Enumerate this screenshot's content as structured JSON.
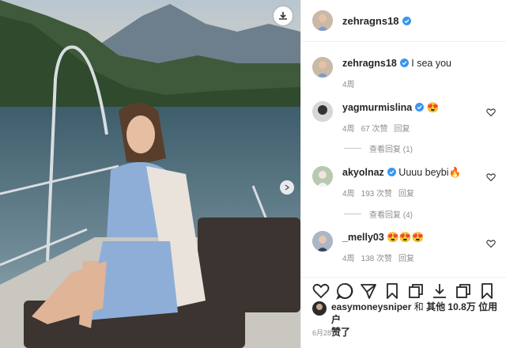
{
  "post": {
    "author": "zehragns18",
    "caption": "I sea you",
    "caption_age": "4周",
    "date": "6月28日"
  },
  "comments": [
    {
      "user": "yagmurmislina",
      "text": "😍",
      "age": "4周",
      "likes": "67 次赞",
      "reply": "回复"
    },
    {
      "user": "akyolnaz",
      "text": "Uuuu beybi🔥",
      "age": "4周",
      "likes": "193 次赞",
      "reply": "回复"
    },
    {
      "user": "_melly03",
      "text": "😍😍😍",
      "age": "4周",
      "likes": "138 次赞",
      "reply": "回复"
    }
  ],
  "view_replies": [
    "查看回复 (1)",
    "查看回复 (4)"
  ],
  "likes": {
    "user": "easymoneysniper",
    "and": "和",
    "others": "其他 10.8万 位用户",
    "suffix": "赞了"
  },
  "icons": [
    "download-icon",
    "next-arrow-icon",
    "verified-badge-icon",
    "heart-icon",
    "comment-icon",
    "share-icon",
    "bookmark-icon"
  ],
  "colors": {
    "verified": "#3897f0",
    "muted": "#8e8e8e",
    "divider": "#efefef"
  }
}
